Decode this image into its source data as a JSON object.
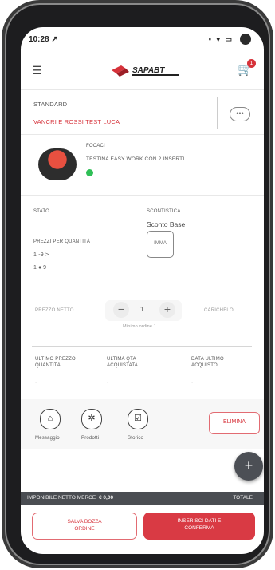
{
  "status_bar": {
    "time": "10:28 ↗",
    "icons": "▪ ▾ ▭"
  },
  "header": {
    "logo_text": "SAPABT",
    "cart_count": "1"
  },
  "customer": {
    "type": "STANDARD",
    "name": "VANCRI E ROSSI TEST LUCA"
  },
  "product": {
    "label": "FOCACI",
    "description": "TESTINA EASY WORK CON 2 INSERTI"
  },
  "fields": {
    "stato": "STATO",
    "scontistica": "SCONTISTICA",
    "sconto_value": "Sconto Base",
    "prezzi_quantita": "PREZZI PER QUANTITÀ",
    "qty_line1": "1 -9 >",
    "qty_line2": "1 ♦ 9",
    "img_btn": "IMMA"
  },
  "quantity": {
    "label_left": "PREZZO NETTO",
    "value": "1",
    "label_right": "CARICHELO",
    "sub": "Minimo ordine 1"
  },
  "history": {
    "col1": [
      "ULTIMO PREZZO",
      "QUANTITÀ"
    ],
    "col2": [
      "ULTIMA QTA",
      "ACQUISTATA"
    ],
    "col3": [
      "DATA ULTIMO",
      "ACQUISTO"
    ],
    "dash": "-"
  },
  "actions": {
    "messaggio": "Messaggio",
    "prodotti": "Prodotti",
    "storico": "Storico",
    "elimina": "ELIMINA"
  },
  "fab": "+",
  "footer_bar": {
    "left_label": "IMPONIBILE NETTO MERCE",
    "left_value": "€ 0,00",
    "right_label": "TOTALE"
  },
  "buttons": {
    "save": [
      "SALVA BOZZA",
      "ORDINE"
    ],
    "confirm": [
      "INSERISCI DATI E",
      "CONFERMA"
    ]
  }
}
